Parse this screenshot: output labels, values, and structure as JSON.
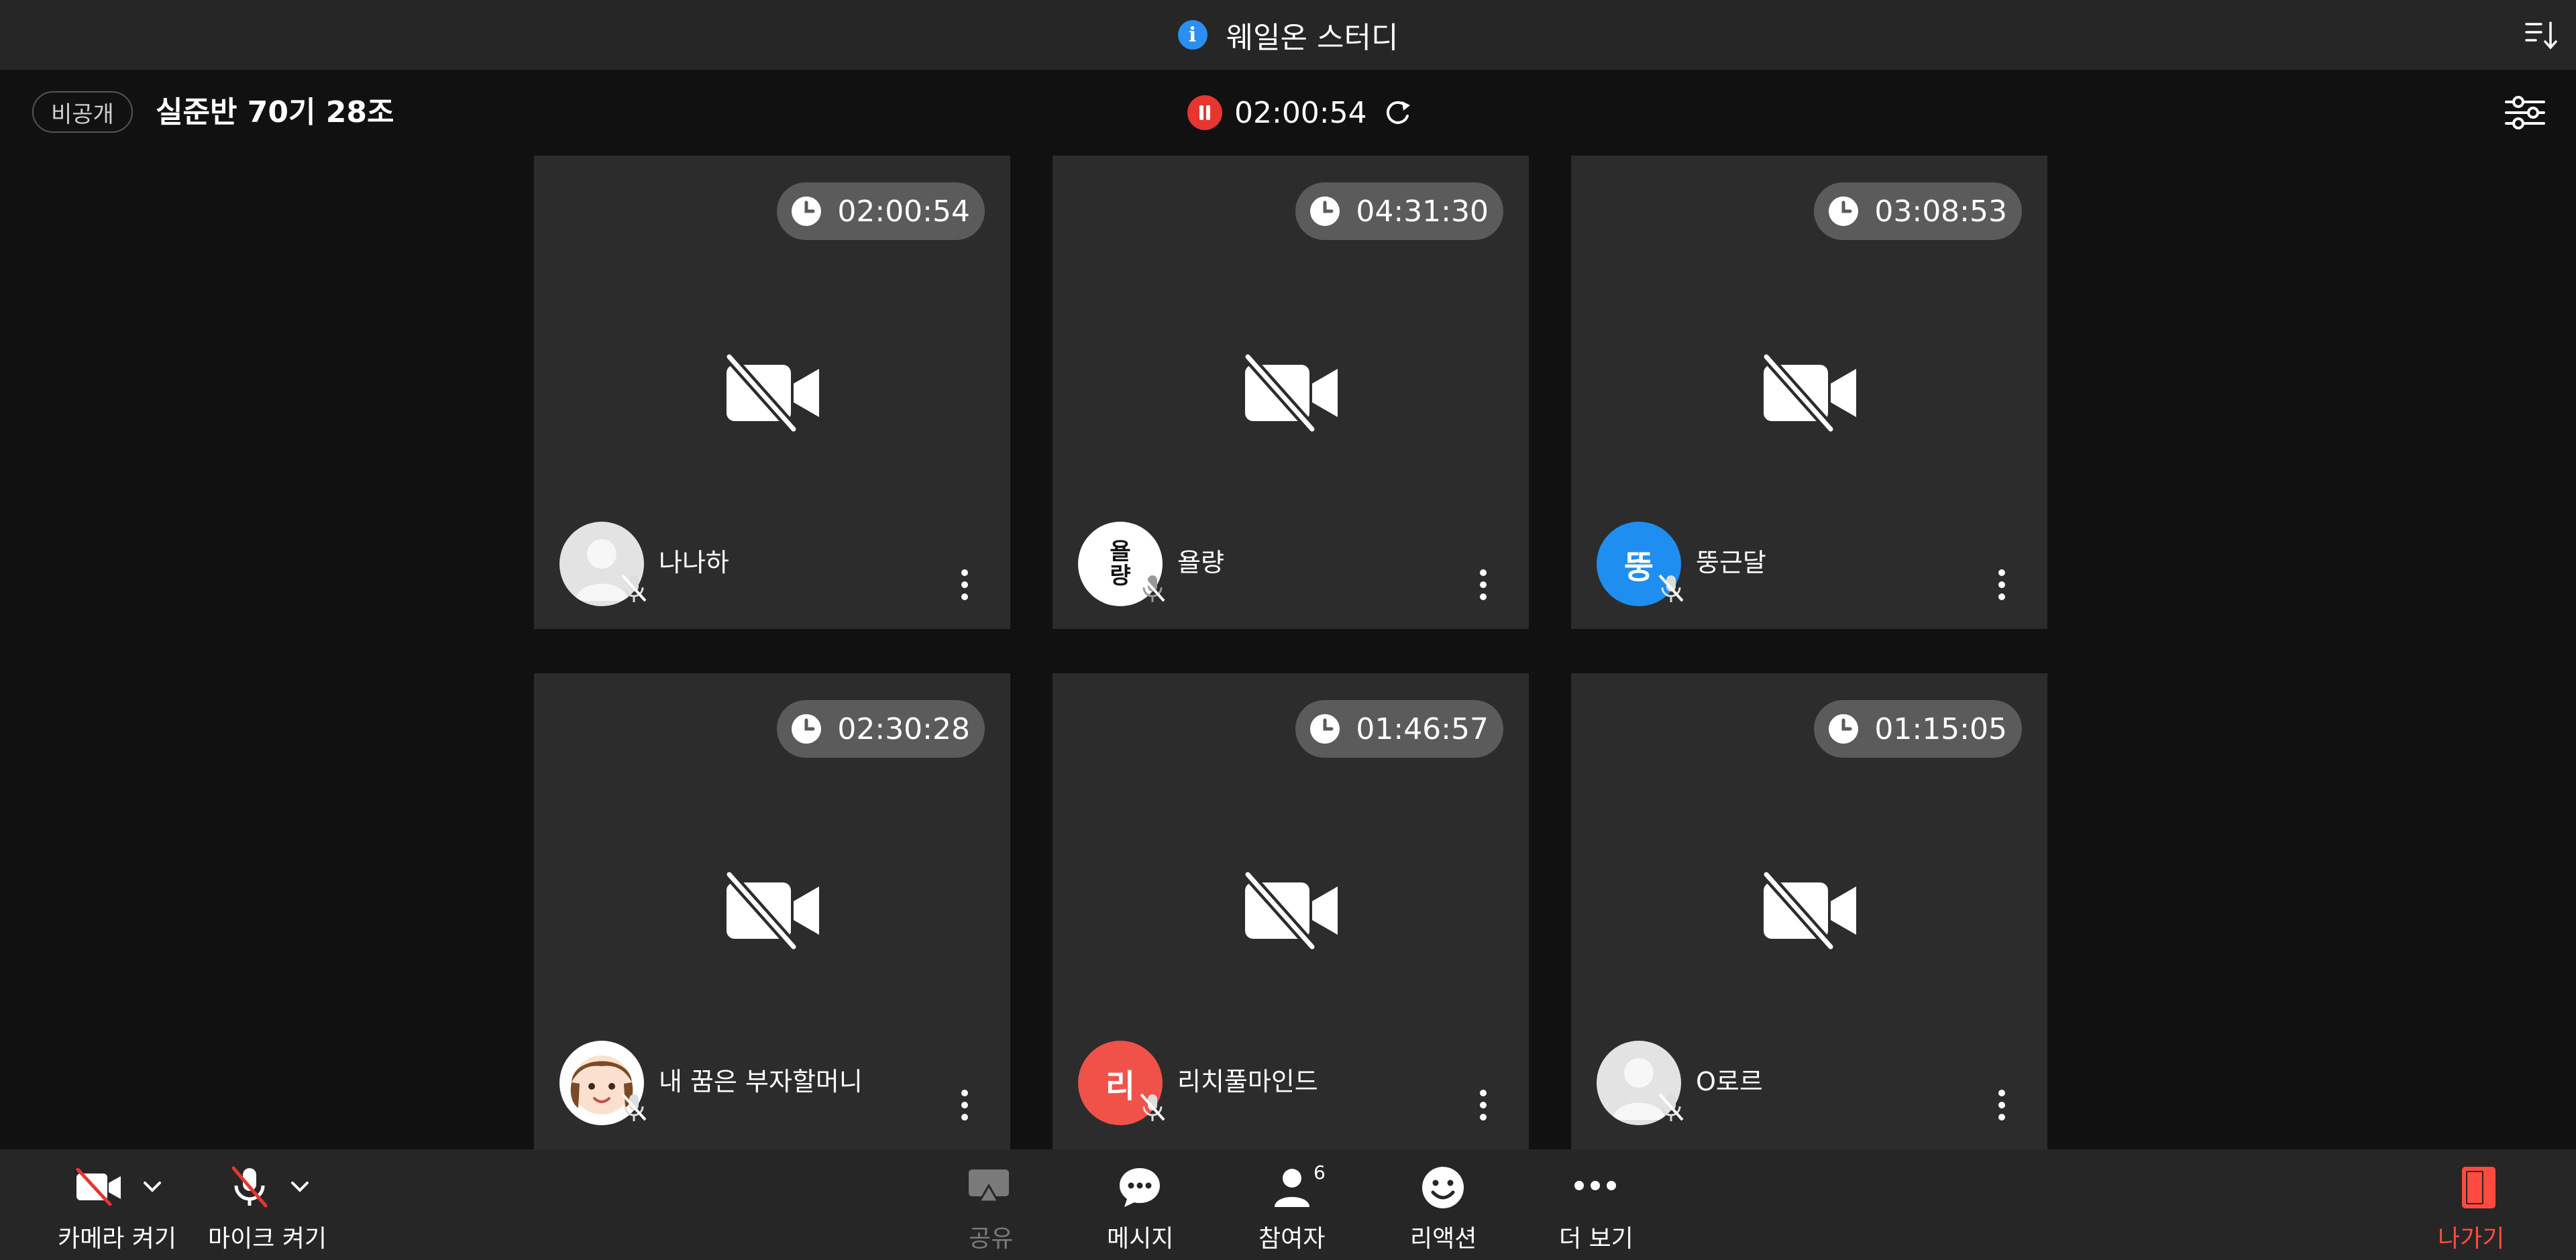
{
  "app": {
    "title": "웨일온 스터디",
    "info_icon": "i"
  },
  "room": {
    "visibility": "비공개",
    "name": "실준반 70기 28조",
    "recording_time": "02:00:54"
  },
  "participants": [
    {
      "name": "나나하",
      "timer": "02:00:54",
      "avatar_type": "default",
      "avatar_text": ""
    },
    {
      "name": "욜량",
      "timer": "04:31:30",
      "avatar_type": "text-white",
      "avatar_text": "욜\n량"
    },
    {
      "name": "뚱근달",
      "timer": "03:08:53",
      "avatar_type": "text-blue",
      "avatar_text": "뚱"
    },
    {
      "name": "내 꿈은 부자할머니",
      "timer": "02:30:28",
      "avatar_type": "cartoon",
      "avatar_text": ""
    },
    {
      "name": "리치풀마인드",
      "timer": "01:46:57",
      "avatar_type": "text-red",
      "avatar_text": "리"
    },
    {
      "name": "O로르",
      "timer": "01:15:05",
      "avatar_type": "default",
      "avatar_text": ""
    }
  ],
  "toolbar": {
    "camera_label": "카메라 켜기",
    "mic_label": "마이크 켜기",
    "share_label": "공유",
    "message_label": "메시지",
    "participants_label": "참여자",
    "participants_count": "6",
    "reaction_label": "리액션",
    "more_label": "더 보기",
    "leave_label": "나가기"
  },
  "colors": {
    "accent_blue": "#2a8ff0",
    "record_red": "#e6362f",
    "leave_red": "#ff4b3e",
    "avatar_blue": "#1e8ef0",
    "avatar_red": "#f0524a"
  }
}
